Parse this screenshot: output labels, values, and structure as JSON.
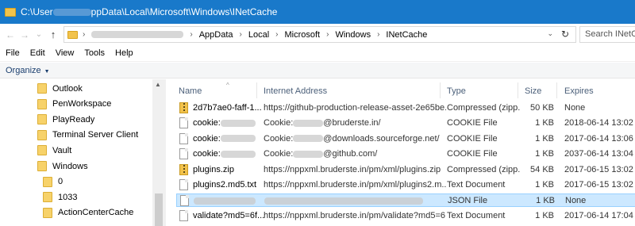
{
  "window": {
    "title_prefix": "C:\\User",
    "title_suffix": "ppData\\Local\\Microsoft\\Windows\\INetCache"
  },
  "nav": {
    "back": "←",
    "forward": "→",
    "recent": "⌄",
    "up": "↑"
  },
  "address": {
    "crumbs": [
      "AppData",
      "Local",
      "Microsoft",
      "Windows",
      "INetCache"
    ],
    "separator": "›",
    "refresh": "↻",
    "dropdown": "⌄"
  },
  "search": {
    "placeholder": "Search INetCa"
  },
  "menu": [
    "File",
    "Edit",
    "View",
    "Tools",
    "Help"
  ],
  "command": {
    "organize": "Organize"
  },
  "tree": [
    {
      "label": "Outlook",
      "indent": 1
    },
    {
      "label": "PenWorkspace",
      "indent": 1
    },
    {
      "label": "PlayReady",
      "indent": 1
    },
    {
      "label": "Terminal Server Client",
      "indent": 1
    },
    {
      "label": "Vault",
      "indent": 1
    },
    {
      "label": "Windows",
      "indent": 1
    },
    {
      "label": "0",
      "indent": 2
    },
    {
      "label": "1033",
      "indent": 2
    },
    {
      "label": "ActionCenterCache",
      "indent": 2
    }
  ],
  "columns": [
    "Name",
    "Internet Address",
    "Type",
    "Size",
    "Expires"
  ],
  "rows": [
    {
      "name": "2d7b7ae0-faff-1...",
      "address": "https://github-production-release-asset-2e65be....",
      "type": "Compressed (zipp...",
      "size": "50 KB",
      "expires": "None",
      "icon": "zip"
    },
    {
      "name": "cookie:",
      "address_pre": "Cookie:",
      "address": "@bruderste.in/",
      "type": "COOKIE File",
      "size": "1 KB",
      "expires": "2018-06-14 13:02",
      "icon": "doc",
      "blur": true
    },
    {
      "name": "cookie:",
      "address_pre": "Cookie:",
      "address": "@downloads.sourceforge.net/",
      "type": "COOKIE File",
      "size": "1 KB",
      "expires": "2017-06-14 13:06",
      "icon": "doc",
      "blur": true
    },
    {
      "name": "cookie:",
      "address_pre": "Cookie:",
      "address": "@github.com/",
      "type": "COOKIE File",
      "size": "1 KB",
      "expires": "2037-06-14 13:04",
      "icon": "doc",
      "blur": true
    },
    {
      "name": "plugins.zip",
      "address": "https://nppxml.bruderste.in/pm/xml/plugins.zip",
      "type": "Compressed (zipp...",
      "size": "54 KB",
      "expires": "2017-06-15 13:02",
      "icon": "zip"
    },
    {
      "name": "plugins2.md5.txt",
      "address": "https://nppxml.bruderste.in/pm/xml/plugins2.m...",
      "type": "Text Document",
      "size": "1 KB",
      "expires": "2017-06-15 13:02",
      "icon": "doc"
    },
    {
      "name": "",
      "address": "",
      "type": "JSON File",
      "size": "1 KB",
      "expires": "None",
      "icon": "doc",
      "selected": true,
      "fullblur": true
    },
    {
      "name": "validate?md5=6f...",
      "address": "https://nppxml.bruderste.in/pm/validate?md5=6...",
      "type": "Text Document",
      "size": "1 KB",
      "expires": "2017-06-14 17:04",
      "icon": "doc"
    }
  ]
}
